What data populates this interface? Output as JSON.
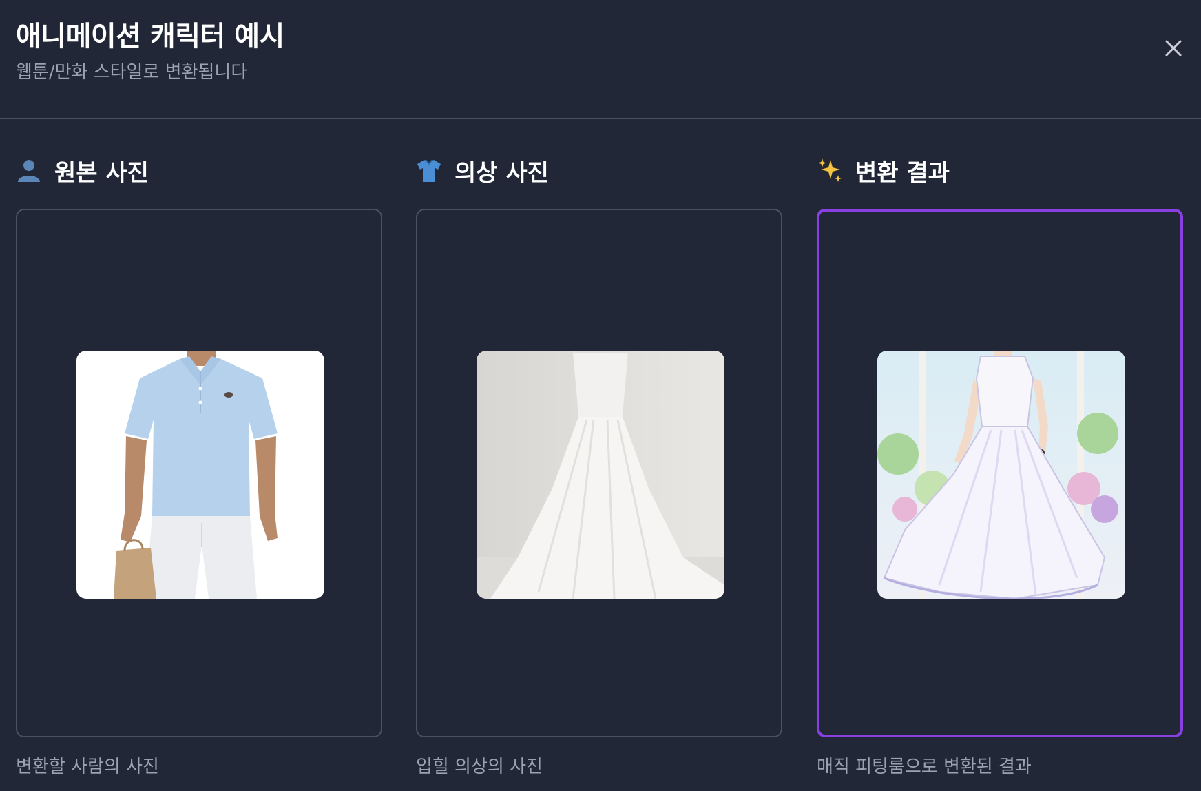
{
  "dialog": {
    "title": "애니메이션 캐릭터 예시",
    "subtitle": "웹툰/만화 스타일로 변환됩니다",
    "close_icon": "close-icon"
  },
  "columns": [
    {
      "icon": "person-silhouette-icon",
      "label": "원본 사진",
      "image": "man-in-light-blue-polo-shirt-photo",
      "caption": "변환할 사람의 사진",
      "highlighted": false
    },
    {
      "icon": "t-shirt-icon",
      "label": "의상 사진",
      "image": "white-wedding-dress-on-mannequin-photo",
      "caption": "입힐 의상의 사진",
      "highlighted": false
    },
    {
      "icon": "sparkles-icon",
      "label": "변환 결과",
      "image": "anime-character-in-white-dress-illustration",
      "caption": "매직 피팅룸으로 변환된 결과",
      "highlighted": true
    }
  ],
  "colors": {
    "background": "#212736",
    "border": "#4a5160",
    "highlight": "#8a3fe0",
    "muted_text": "#9ba3b1"
  }
}
